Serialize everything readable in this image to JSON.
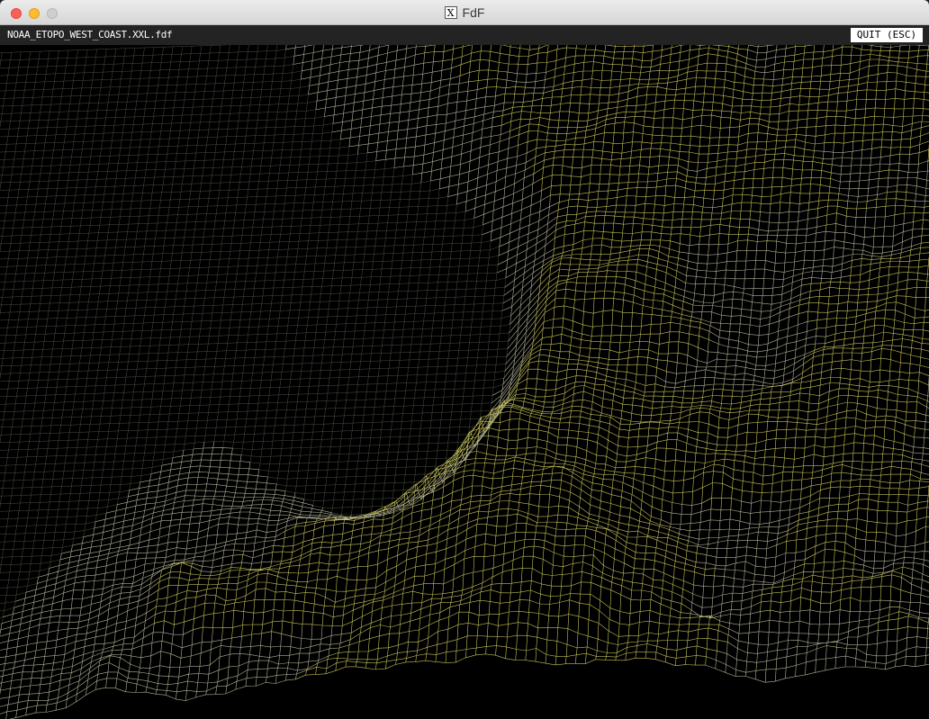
{
  "window": {
    "title": "FdF",
    "app_icon": "x11-icon"
  },
  "toolbar": {
    "filename": "NOAA_ETOPO_WEST_COAST.XXL.fdf",
    "quit_label": "QUIT (ESC)"
  },
  "render": {
    "style": "wireframe",
    "colors": {
      "low": "#8a8a78",
      "mid": "#cfcfb0",
      "high": "#e6e066",
      "background": "#000000"
    }
  }
}
